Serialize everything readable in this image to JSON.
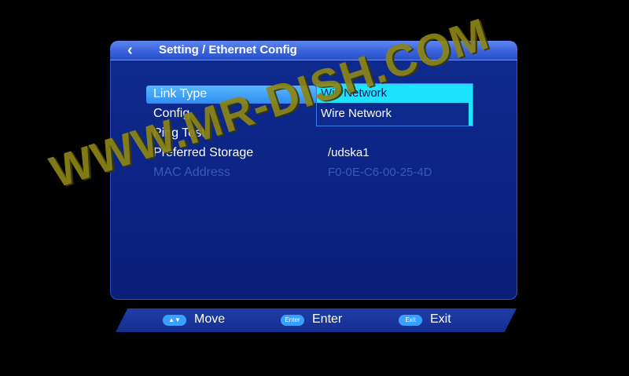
{
  "header": {
    "back_icon": "chevron-left-icon",
    "title": "Setting / Ethernet Config"
  },
  "menu": {
    "items": [
      {
        "label": "Link Type",
        "value": ""
      },
      {
        "label": "Config",
        "value": ""
      },
      {
        "label": "Ping Test",
        "value": ""
      },
      {
        "label": "Preferred Storage",
        "value": "/udska1"
      },
      {
        "label": "MAC Address",
        "value": "F0-0E-C6-00-25-4D"
      }
    ]
  },
  "dropdown": {
    "options": [
      "Wifi Network",
      "Wire Network"
    ],
    "selected": "Wifi Network"
  },
  "footer": {
    "hints": [
      {
        "key": "▲▼",
        "label": "Move"
      },
      {
        "key": "Enter",
        "label": "Enter"
      },
      {
        "key": "Exit",
        "label": "Exit"
      }
    ]
  },
  "watermark": "WWW.MR-DISH.COM",
  "colors": {
    "panel": "#0f2b8f",
    "highlight": "#2f8cf0",
    "dropdown_selected": "#1ee3ff",
    "watermark": "#8c8516"
  }
}
